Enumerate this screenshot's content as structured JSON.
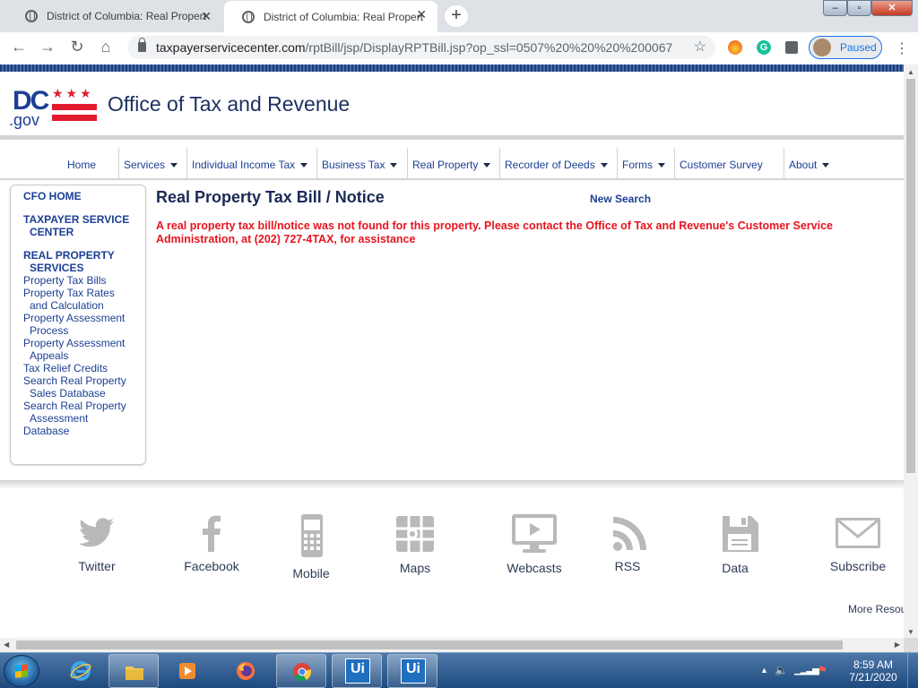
{
  "browser": {
    "tabs": [
      {
        "title": "District of Columbia: Real Propert",
        "active": false
      },
      {
        "title": "District of Columbia: Real Propert",
        "active": true
      }
    ],
    "url_host": "taxpayerservicecenter.com",
    "url_path": "/rptBill/jsp/DisplayRPTBill.jsp?op_ssl=0507%20%20%20%200067",
    "profile_status": "Paused",
    "extension_grammarly_glyph": "G"
  },
  "header": {
    "logo_dc": "DC",
    "logo_gov": ".gov",
    "logo_stars": "★★★",
    "site_title": "Office of Tax and Revenue"
  },
  "nav": {
    "items": [
      {
        "label": "Home",
        "dropdown": false
      },
      {
        "label": "Services",
        "dropdown": true
      },
      {
        "label": "Individual Income Tax",
        "dropdown": true
      },
      {
        "label": "Business Tax",
        "dropdown": true
      },
      {
        "label": "Real Property",
        "dropdown": true
      },
      {
        "label": "Recorder of Deeds",
        "dropdown": true
      },
      {
        "label": "Forms",
        "dropdown": true
      },
      {
        "label": "Customer Survey",
        "dropdown": false
      },
      {
        "label": "About",
        "dropdown": true
      }
    ]
  },
  "sidebar": {
    "cfo_home": "CFO HOME",
    "taxpayer_service_line1": "TAXPAYER SERVICE",
    "taxpayer_service_line2": "CENTER",
    "real_property_line1": "REAL PROPERTY",
    "real_property_line2": "SERVICES",
    "links": [
      [
        "Property Tax Bills"
      ],
      [
        "Property Tax Rates",
        "and Calculation"
      ],
      [
        "Property Assessment",
        "Process"
      ],
      [
        "Property Assessment",
        "Appeals"
      ],
      [
        "Tax Relief Credits"
      ],
      [
        "Search Real Property",
        "Sales Database"
      ],
      [
        "Search Real Property",
        "Assessment"
      ]
    ],
    "last_line": "Database"
  },
  "main": {
    "title": "Real Property Tax Bill / Notice",
    "new_search": "New Search",
    "error_message": "A real property tax bill/notice was not found for this property. Please contact the Office of Tax and Revenue's Customer Service Administration, at (202) 727-4TAX, for assistance"
  },
  "footer": {
    "social": [
      {
        "label": "Twitter",
        "icon": "twitter-icon"
      },
      {
        "label": "Facebook",
        "icon": "facebook-icon"
      },
      {
        "label": "Mobile",
        "icon": "mobile-icon"
      },
      {
        "label": "Maps",
        "icon": "maps-icon"
      },
      {
        "label": "Webcasts",
        "icon": "webcast-icon"
      },
      {
        "label": "RSS",
        "icon": "rss-icon"
      },
      {
        "label": "Data",
        "icon": "data-icon"
      },
      {
        "label": "Subscribe",
        "icon": "subscribe-icon"
      }
    ],
    "more_resources": "More Resources"
  },
  "taskbar": {
    "time": "8:59 AM",
    "date": "7/21/2020",
    "apps": [
      "internet-explorer",
      "file-explorer",
      "media-player",
      "firefox",
      "chrome",
      "uipath",
      "uipath"
    ],
    "uipath_glyph": "Ui"
  },
  "colors": {
    "brand_blue": "#1b3f94",
    "error_red": "#e8141f",
    "dc_red": "#e21c2f",
    "icon_gray": "#b9b9b9"
  }
}
